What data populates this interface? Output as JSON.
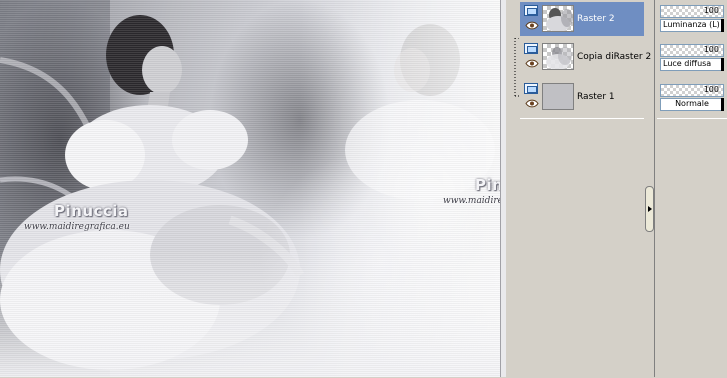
{
  "canvas": {
    "watermarks": [
      {
        "title": "Pinuccia",
        "url": "www.maidiregrafica.eu"
      },
      {
        "title": "Pinuccia",
        "url": "www.maidiregrafica.eu"
      }
    ]
  },
  "layers": {
    "items": [
      {
        "name": "Raster 2",
        "selected": true,
        "thumb": "portrait",
        "icon": "raster-layer-icon",
        "visibility_icon": "eye-icon"
      },
      {
        "name": "Copia diRaster 2",
        "selected": false,
        "thumb": "portrait",
        "icon": "raster-layer-icon",
        "visibility_icon": "eye-icon"
      },
      {
        "name": "Raster 1",
        "selected": false,
        "thumb": "gray",
        "icon": "raster-layer-icon",
        "visibility_icon": "eye-icon"
      }
    ]
  },
  "properties": {
    "rows": [
      {
        "opacity": "100",
        "blend_mode": "Luminanza (L)"
      },
      {
        "opacity": "100",
        "blend_mode": "Luce diffusa"
      },
      {
        "opacity": "100",
        "blend_mode": "Normale"
      }
    ]
  },
  "colors": {
    "panel_bg": "#d4d0c8",
    "selection": "#6f8ec2",
    "field_border": "#7f9db9"
  }
}
